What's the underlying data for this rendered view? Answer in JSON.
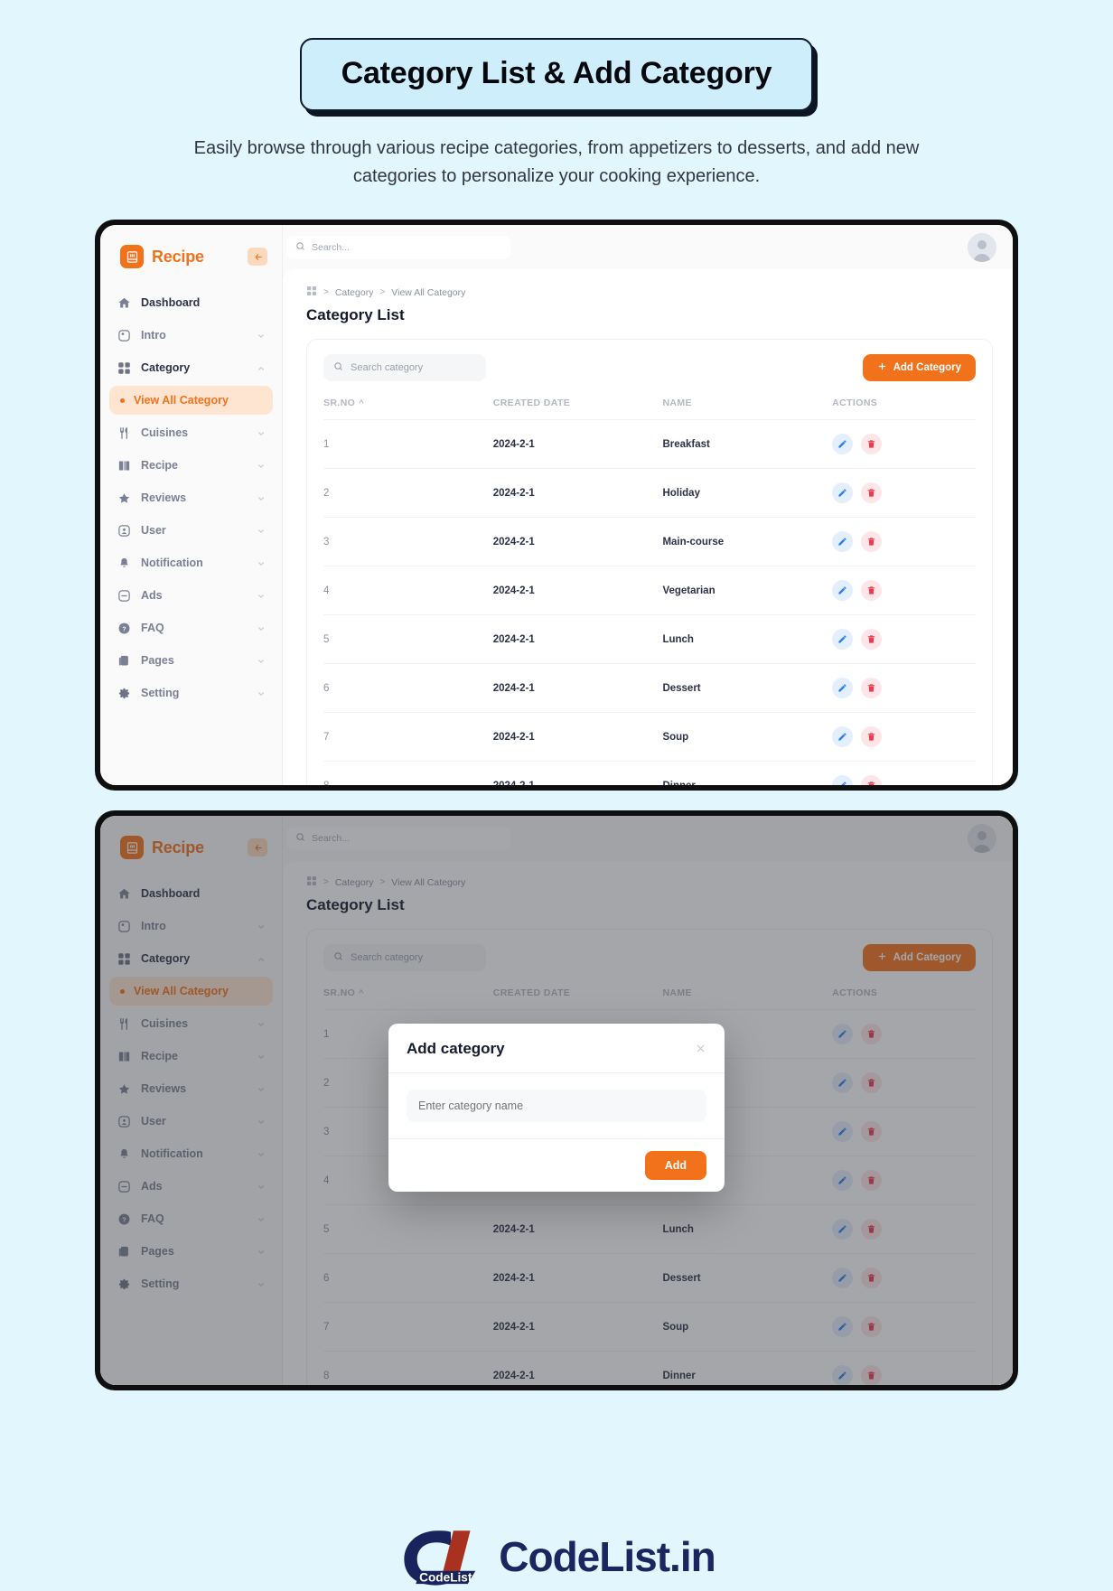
{
  "header": {
    "title": "Category List & Add Category",
    "subtitle": "Easily browse through various recipe categories, from appetizers to desserts, and add new categories to personalize your cooking experience."
  },
  "app": {
    "brand": "Recipe",
    "collapse_icon": "sidebar-collapse-icon",
    "topbar": {
      "search_placeholder": "Search...",
      "search_value": "",
      "search_icon": "search-icon",
      "avatar": "user-avatar"
    },
    "sidebar": {
      "items": [
        {
          "label": "Dashboard",
          "icon": "home-icon",
          "expandable": false
        },
        {
          "label": "Intro",
          "icon": "intro-icon",
          "expandable": true
        },
        {
          "label": "Category",
          "icon": "grid-icon",
          "expandable": true,
          "expanded": true
        },
        {
          "label": "Cuisines",
          "icon": "cutlery-icon",
          "expandable": true
        },
        {
          "label": "Recipe",
          "icon": "book-icon",
          "expandable": true
        },
        {
          "label": "Reviews",
          "icon": "star-icon",
          "expandable": true
        },
        {
          "label": "User",
          "icon": "user-icon",
          "expandable": true
        },
        {
          "label": "Notification",
          "icon": "bell-icon",
          "expandable": true
        },
        {
          "label": "Ads",
          "icon": "ads-icon",
          "expandable": true
        },
        {
          "label": "FAQ",
          "icon": "faq-icon",
          "expandable": true
        },
        {
          "label": "Pages",
          "icon": "pages-icon",
          "expandable": true
        },
        {
          "label": "Setting",
          "icon": "gear-icon",
          "expandable": true
        }
      ],
      "sub_item": {
        "label": "View All Category",
        "parent": "Category"
      }
    },
    "breadcrumb": {
      "home_icon": "grid-icon",
      "items": [
        "Category",
        "View All Category"
      ],
      "separator": ">"
    },
    "page_title": "Category List",
    "card": {
      "search_placeholder": "Search category",
      "search_icon": "search-icon",
      "add_button": "Add Category",
      "add_button_icon": "plus-icon"
    },
    "table": {
      "columns": [
        "SR.NO",
        "CREATED DATE",
        "NAME",
        "ACTIONS"
      ],
      "sort_column": "SR.NO",
      "sort_direction": "asc",
      "rows": [
        {
          "sr": "1",
          "date": "2024-2-1",
          "name": "Breakfast"
        },
        {
          "sr": "2",
          "date": "2024-2-1",
          "name": "Holiday"
        },
        {
          "sr": "3",
          "date": "2024-2-1",
          "name": "Main-course"
        },
        {
          "sr": "4",
          "date": "2024-2-1",
          "name": "Vegetarian"
        },
        {
          "sr": "5",
          "date": "2024-2-1",
          "name": "Lunch"
        },
        {
          "sr": "6",
          "date": "2024-2-1",
          "name": "Dessert"
        },
        {
          "sr": "7",
          "date": "2024-2-1",
          "name": "Soup"
        },
        {
          "sr": "8",
          "date": "2024-2-1",
          "name": "Dinner"
        }
      ],
      "row_actions": {
        "edit_icon": "pencil-icon",
        "delete_icon": "trash-icon"
      }
    },
    "modal": {
      "title": "Add category",
      "close_icon": "close-icon",
      "input_placeholder": "Enter category name",
      "input_value": "",
      "submit_label": "Add"
    }
  },
  "footer": {
    "brand_mark": "CodeList",
    "brand_text": "CodeList.in"
  },
  "colors": {
    "page_bg": "#e2f6fd",
    "accent": "#f2721b",
    "accent_soft": "#fde5d1",
    "edit_blue": "#2f80ed",
    "delete_red": "#eb3b4f",
    "text_dark": "#131a2e",
    "text_muted": "#8b91a1"
  }
}
